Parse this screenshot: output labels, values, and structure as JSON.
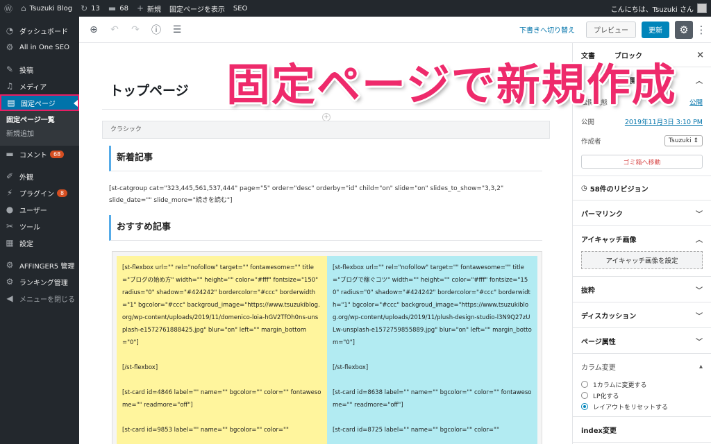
{
  "adminbar": {
    "site_name": "Tsuzuki Blog",
    "updates_count": "13",
    "comments_count": "68",
    "new_label": "新規",
    "view_page_label": "固定ページを表示",
    "seo_label": "SEO",
    "greeting": "こんにちは、Tsuzuki さん"
  },
  "sidebar": {
    "items": [
      {
        "label": "ダッシュボード"
      },
      {
        "label": "All in One SEO"
      },
      {
        "label": "投稿"
      },
      {
        "label": "メディア"
      },
      {
        "label": "固定ページ"
      },
      {
        "label": "コメント",
        "badge": "68"
      },
      {
        "label": "外観"
      },
      {
        "label": "プラグイン",
        "badge": "8"
      },
      {
        "label": "ユーザー"
      },
      {
        "label": "ツール"
      },
      {
        "label": "設定"
      },
      {
        "label": "AFFINGER5 管理"
      },
      {
        "label": "ランキング管理"
      },
      {
        "label": "メニューを閉じる"
      }
    ],
    "submenu": [
      "固定ページ一覧",
      "新規追加"
    ]
  },
  "toolbar": {
    "switch_label": "下書きへ切り替え",
    "preview_label": "プレビュー",
    "update_label": "更新"
  },
  "editor": {
    "page_title": "トップページ",
    "classic_label": "クラシック",
    "heading1": "新着記事",
    "shortcode1": "[st-catgroup cat=\"323,445,561,537,444\" page=\"5\" order=\"desc\" orderby=\"id\" child=\"on\" slide=\"on\" slides_to_show=\"3,3,2\" slide_date=\"\" slide_more=\"続きを読む\"]",
    "heading2": "おすすめ記事",
    "left_col": {
      "flexbox": "[st-flexbox url=\"\" rel=\"nofollow\" target=\"\" fontawesome=\"\" title=\"ブログの始め方\" width=\"\" height=\"\" color=\"#fff\" fontsize=\"150\" radius=\"0\" shadow=\"#424242\" bordercolor=\"#ccc\" borderwidth=\"1\" bgcolor=\"#ccc\" backgroud_image=\"https://www.tsuzukiblog.org/wp-content/uploads/2019/11/domenico-loia-hGV2TfOh0ns-unsplash-e1572761888425.jpg\" blur=\"on\" left=\"\" margin_bottom=\"0\"]",
      "flexbox_close": "[/st-flexbox]",
      "card1": "[st-card id=4846 label=\"\" name=\"\" bgcolor=\"\" color=\"\" fontawesome=\"\" readmore=\"off\"]",
      "card2": "[st-card id=9853 label=\"\" name=\"\" bgcolor=\"\" color=\"\""
    },
    "right_col": {
      "flexbox": "[st-flexbox url=\"\" rel=\"nofollow\" target=\"\" fontawesome=\"\" title=\"ブログで稼ぐコツ\" width=\"\" height=\"\" color=\"#fff\" fontsize=\"150\" radius=\"0\" shadow=\"#424242\" bordercolor=\"#ccc\" borderwidth=\"1\" bgcolor=\"#ccc\" backgroud_image=\"https://www.tsuzukiblog.org/wp-content/uploads/2019/11/plush-design-studio-l3N9Q27zULw-unsplash-e1572759855889.jpg\" blur=\"on\" left=\"\" margin_bottom=\"0\"]",
      "flexbox_close": "[/st-flexbox]",
      "card1": "[st-card id=8638 label=\"\" name=\"\" bgcolor=\"\" color=\"\" fontawesome=\"\" readmore=\"off\"]",
      "card2": "[st-card id=8725 label=\"\" name=\"\" bgcolor=\"\" color=\"\""
    }
  },
  "panel": {
    "tab_document": "文書",
    "tab_block": "ブロック",
    "status_section": "公開状態",
    "visibility_label": "公開状態",
    "visibility_value": "公開",
    "publish_label": "公開",
    "publish_value": "2019年11月3日 3:10 PM",
    "author_label": "作成者",
    "author_value": "Tsuzuki",
    "trash_label": "ゴミ箱へ移動",
    "revisions": "58件のリビジョン",
    "permalink": "パーマリンク",
    "eyecatch": "アイキャッチ画像",
    "eyecatch_button": "アイキャッチ画像を設定",
    "excerpt": "抜粋",
    "discussion": "ディスカッション",
    "page_attributes": "ページ属性",
    "column_change": "カラム変更",
    "radio1": "1カラムに変更する",
    "radio2": "LP化する",
    "radio3": "レイアウトをリセットする",
    "index_change": "index変更"
  },
  "overlay": {
    "caption": "固定ページで新規作成"
  },
  "colors": {
    "admin_dark": "#23282d",
    "admin_blue": "#0073aa",
    "highlight_pink": "#ee2a6b",
    "left_column_bg": "#fff59d",
    "right_column_bg": "#b2ebf2"
  }
}
